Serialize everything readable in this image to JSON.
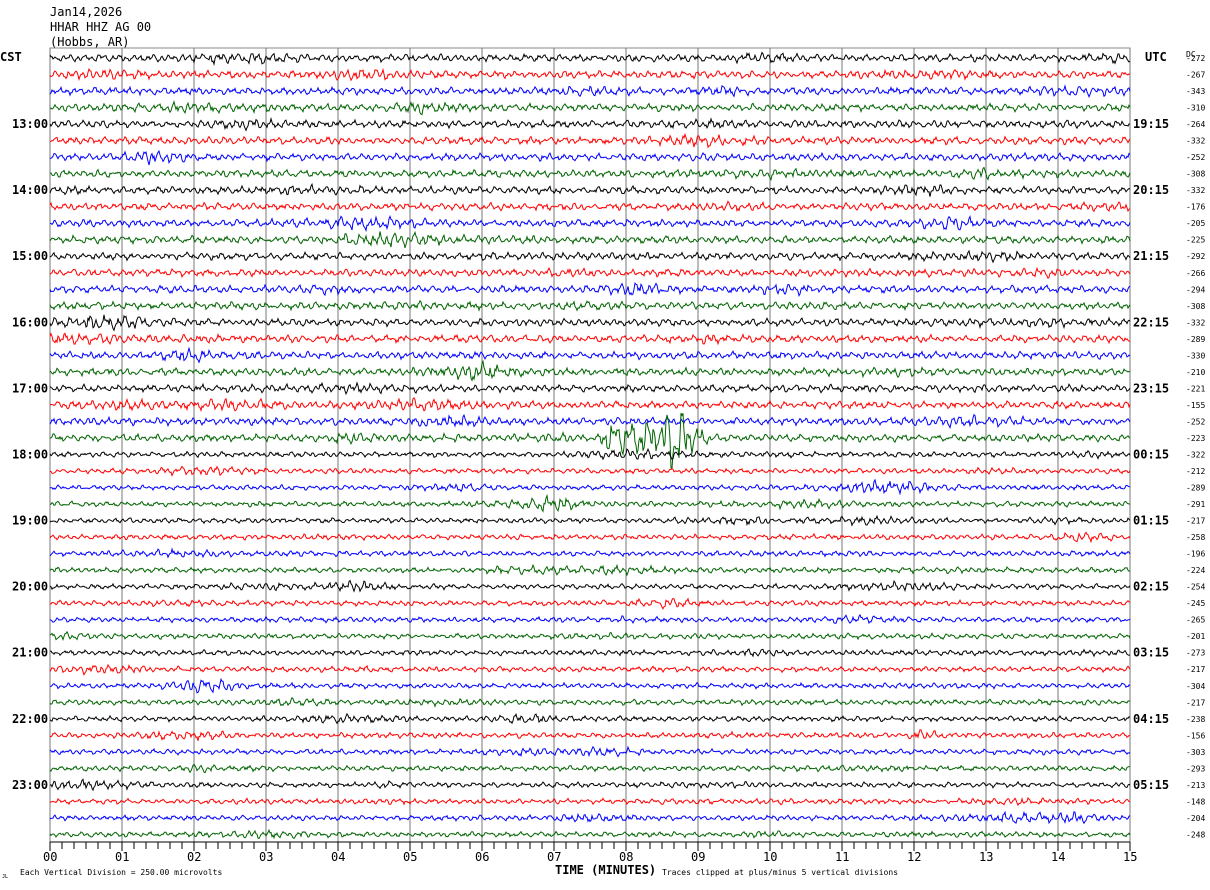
{
  "header": {
    "date": "Jan14,2026",
    "station": "HHAR HHZ AG 00",
    "location": "(Hobbs, AR)"
  },
  "chart_data": {
    "type": "line",
    "subtype": "helicorder",
    "left_timezone": "CST",
    "right_timezone": "UTC",
    "dc_header": "DC",
    "xlabel": "TIME (MINUTES)",
    "xlim": [
      0,
      15
    ],
    "x_ticks": [
      "00",
      "01",
      "02",
      "03",
      "04",
      "05",
      "06",
      "07",
      "08",
      "09",
      "10",
      "11",
      "12",
      "13",
      "14",
      "15"
    ],
    "minutes_per_line": 15,
    "trace_colors": [
      "#000000",
      "#ff0000",
      "#0000ff",
      "#006400"
    ],
    "left_labels": [
      "13:00",
      "14:00",
      "15:00",
      "16:00",
      "17:00",
      "18:00",
      "19:00",
      "20:00",
      "21:00",
      "22:00",
      "23:00"
    ],
    "right_labels": [
      "19:15",
      "20:15",
      "21:15",
      "22:15",
      "23:15",
      "00:15",
      "01:15",
      "02:15",
      "03:15",
      "04:15",
      "05:15"
    ],
    "dc_offsets": [
      "-272",
      "-267",
      "-343",
      "-310",
      "-264",
      "-332",
      "-252",
      "-308",
      "-332",
      "-176",
      "-205",
      "-225",
      "-292",
      "-266",
      "-294",
      "-308",
      "-332",
      "-289",
      "-330",
      "-210",
      "-221",
      "-155",
      "-252",
      "-223",
      "-322",
      "-212",
      "-289",
      "-291",
      "-217",
      "-258",
      "-196",
      "-224",
      "-254",
      "-245",
      "-265",
      "-201",
      "-273",
      "-217",
      "-304",
      "-217",
      "-238",
      "-156",
      "-303",
      "-293",
      "-213",
      "-148",
      "-204",
      "-248"
    ],
    "grid": true,
    "events": [
      {
        "line": 23,
        "start_min": 7.7,
        "end_min": 8.9,
        "label": ""
      }
    ]
  },
  "footer": {
    "scale": "Each Vertical Division =  250.00 microvolts",
    "clip": "Traces clipped at plus/minus 5 vertical divisions",
    "logo": "JL"
  }
}
